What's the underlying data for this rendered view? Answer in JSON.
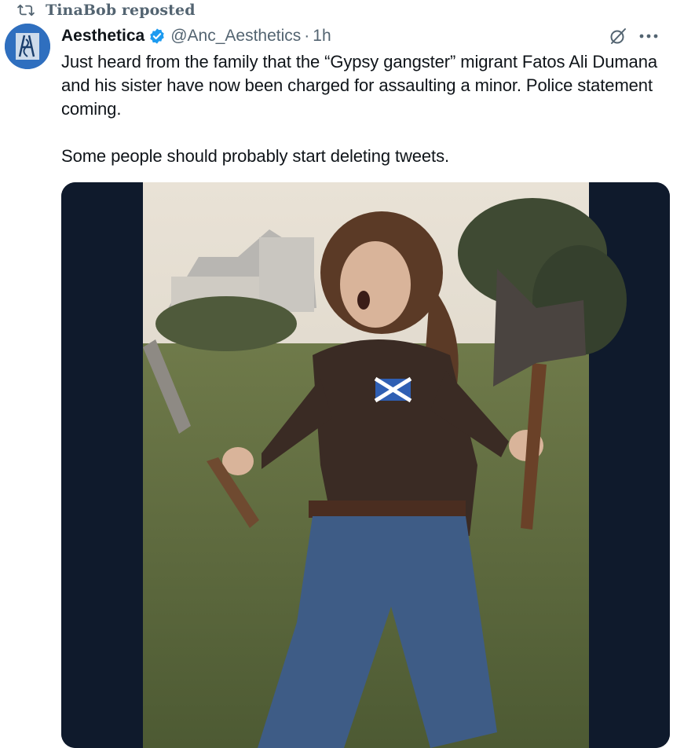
{
  "repost": {
    "label": "TinaBob reposted",
    "icon": "repost-icon"
  },
  "author": {
    "name": "Aesthetica",
    "verified": true,
    "handle": "@Anc_Aesthetics",
    "separator": "·",
    "time": "1h",
    "avatar_text": "AS"
  },
  "tweet": {
    "text": "Just heard from the family that the “Gypsy gangster” migrant Fatos Ali Dumana and his sister have now been charged for assaulting a minor. Police statement coming.\n\nSome people should probably start deleting tweets."
  },
  "colors": {
    "secondary_text": "#536471",
    "verified_blue": "#1d9bf0",
    "media_border": "#0f1a2c"
  },
  "icons": [
    "repost-icon",
    "verified-badge-icon",
    "grok-icon",
    "more-icon"
  ],
  "media": {
    "description_visible": false
  }
}
